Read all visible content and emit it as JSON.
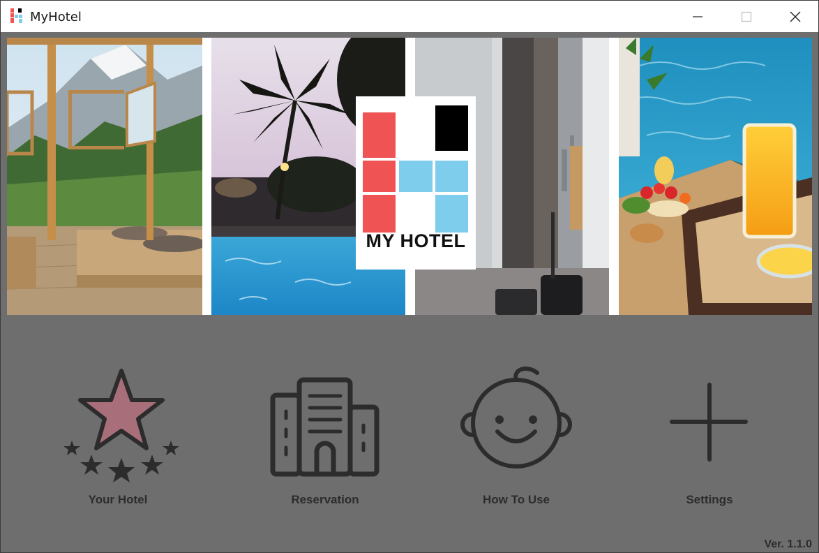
{
  "window": {
    "title": "MyHotel",
    "controls": [
      "minimize",
      "maximize",
      "close"
    ]
  },
  "banner": {
    "logo_text": "MY HOTEL",
    "panels": [
      "mountain-lodge-room",
      "palm-pool-evening",
      "city-view-room",
      "breakfast-tray-pool"
    ]
  },
  "menu": {
    "items": [
      {
        "label": "Your Hotel",
        "icon": "stars-icon"
      },
      {
        "label": "Reservation",
        "icon": "building-icon"
      },
      {
        "label": "How To Use",
        "icon": "baby-face-icon"
      },
      {
        "label": "Settings",
        "icon": "plus-icon"
      }
    ]
  },
  "version": "Ver. 1.1.0",
  "colors": {
    "background": "#6e6e6e",
    "icon_stroke": "#2c2c2c",
    "star_fill": "#a86f7b",
    "logo_red": "#ef5354",
    "logo_blue": "#7fcdec",
    "logo_black": "#000000"
  }
}
